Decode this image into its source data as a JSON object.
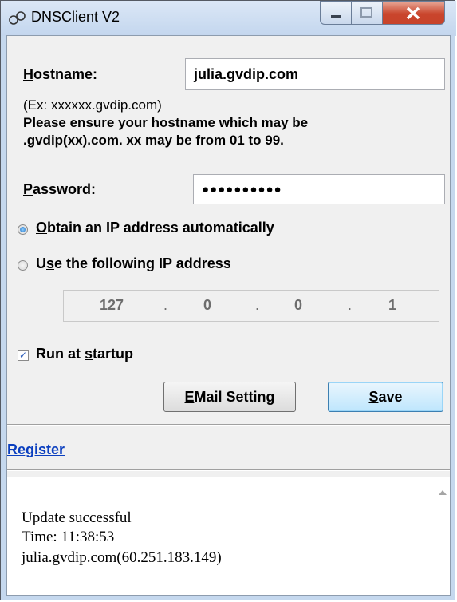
{
  "window": {
    "title": "DNSClient V2",
    "icons": {
      "app": "network-app-icon",
      "minimize": "minimize-icon",
      "maximize": "maximize-icon",
      "close": "close-icon"
    }
  },
  "form": {
    "hostname_label_u": "H",
    "hostname_label_rest": "ostname:",
    "hostname_value": "julia.gvdip.com",
    "hint_example": "(Ex: xxxxxx.gvdip.com)",
    "hint_line2": "Please ensure your hostname which may be",
    "hint_line3": ".gvdip(xx).com. xx may be from 01 to 99.",
    "password_label_u": "P",
    "password_label_rest": "assword:",
    "password_masked": "●●●●●●●●●●",
    "radio_auto_u": "O",
    "radio_auto_rest": "btain an IP address automatically",
    "radio_auto_selected": true,
    "radio_manual_pre": "U",
    "radio_manual_u": "s",
    "radio_manual_rest": "e the following IP address",
    "ip_octets": [
      "127",
      "0",
      "0",
      "1"
    ],
    "ip_sep": ".",
    "startup_pre": "Run at ",
    "startup_u": "s",
    "startup_rest": "tartup",
    "startup_checked": true,
    "check_mark": "✓"
  },
  "buttons": {
    "email_u": "E",
    "email_rest": "Mail Setting",
    "save_u": "S",
    "save_rest": "ave"
  },
  "register": {
    "u": "R",
    "rest": "egister"
  },
  "log": {
    "lines": [
      "Update successful",
      "Time: 11:38:53",
      "julia.gvdip.com(60.251.183.149)"
    ]
  },
  "colors": {
    "titlebar": "#c3d6ee",
    "close": "#c9452c",
    "link": "#0b3fbf",
    "radio_dot": "#1f6fc4"
  }
}
